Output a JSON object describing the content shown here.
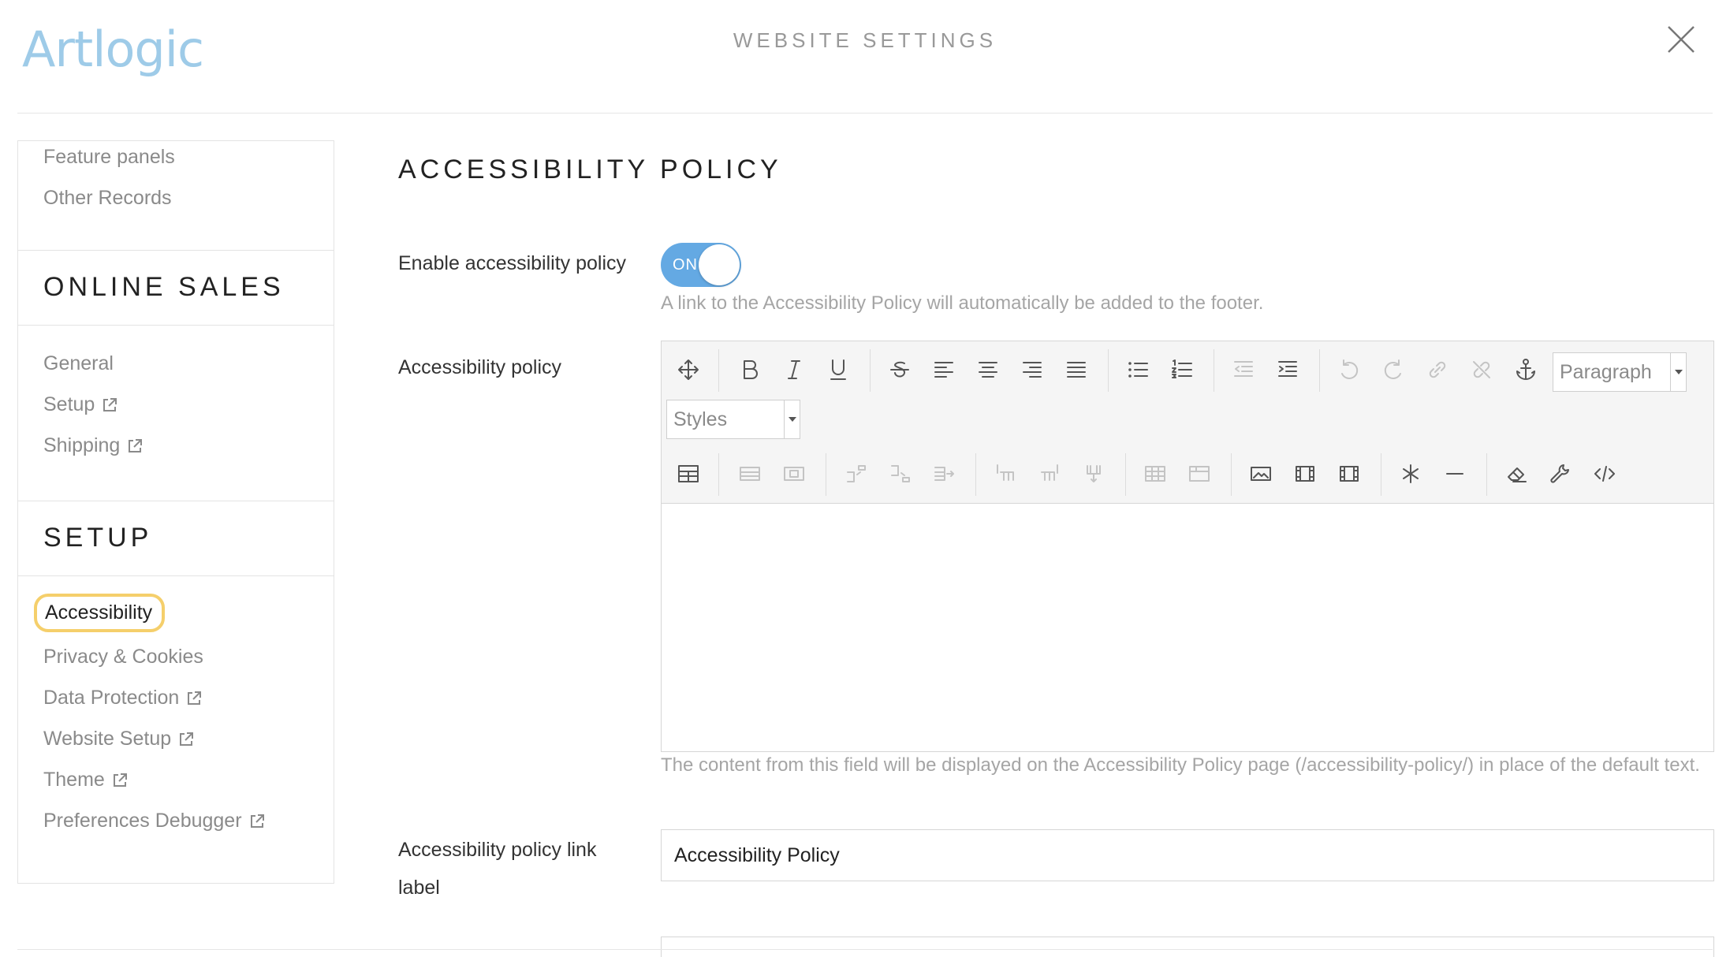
{
  "header": {
    "logo_text": "Artlogic",
    "title": "WEBSITE SETTINGS",
    "close_icon": "close-icon"
  },
  "sidebar": {
    "top_items": [
      {
        "label": "Feature panels",
        "external": false
      },
      {
        "label": "Other Records",
        "external": false
      }
    ],
    "sections": [
      {
        "heading": "ONLINE SALES",
        "items": [
          {
            "label": "General",
            "external": false
          },
          {
            "label": "Setup",
            "external": true
          },
          {
            "label": "Shipping",
            "external": true
          }
        ]
      },
      {
        "heading": "SETUP",
        "items": [
          {
            "label": "Accessibility",
            "external": false,
            "active": true
          },
          {
            "label": "Privacy & Cookies",
            "external": false
          },
          {
            "label": "Data Protection",
            "external": true
          },
          {
            "label": "Website Setup",
            "external": true
          },
          {
            "label": "Theme",
            "external": true
          },
          {
            "label": "Preferences Debugger",
            "external": true
          }
        ]
      }
    ]
  },
  "main": {
    "title": "ACCESSIBILITY POLICY",
    "enable_field": {
      "label": "Enable accessibility policy",
      "toggle_text": "ON",
      "toggle_on": true,
      "help": "A link to the Accessibility Policy will automatically be added to the footer."
    },
    "policy_field": {
      "label": "Accessibility policy",
      "format_select": "Paragraph",
      "styles_select": "Styles",
      "content": "",
      "help": "The content from this field will be displayed on the Accessibility Policy page (/accessibility-policy/) in place of the default text."
    },
    "link_label_field": {
      "label": "Accessibility policy link label",
      "value": "Accessibility Policy"
    }
  },
  "colors": {
    "accent": "#64a9e3",
    "logo": "#9ecbe8",
    "active_highlight": "#f5cf6b"
  }
}
